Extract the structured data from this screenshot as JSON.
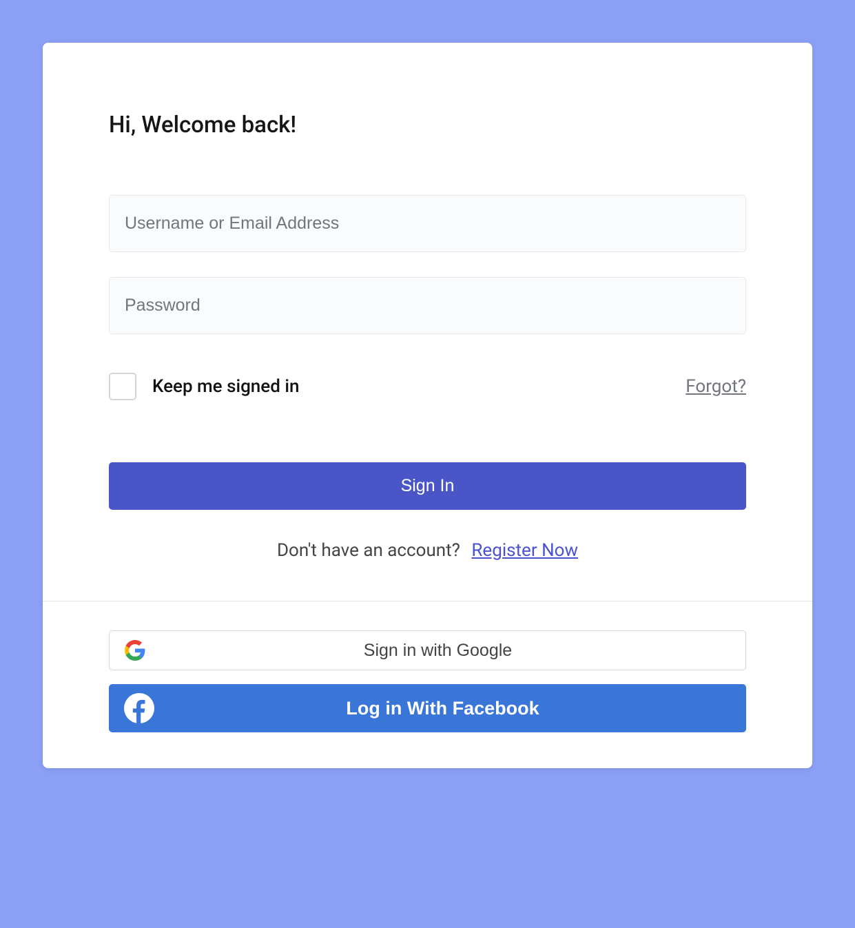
{
  "heading": "Hi, Welcome back!",
  "fields": {
    "username_placeholder": "Username or Email Address",
    "password_placeholder": "Password"
  },
  "keep_signed_label": "Keep me signed in",
  "forgot_label": "Forgot?",
  "signin_label": "Sign In",
  "signup_prompt": "Don't have an account?",
  "signup_link": "Register Now",
  "social": {
    "google_label": "Sign in with Google",
    "facebook_label": "Log in With Facebook"
  }
}
